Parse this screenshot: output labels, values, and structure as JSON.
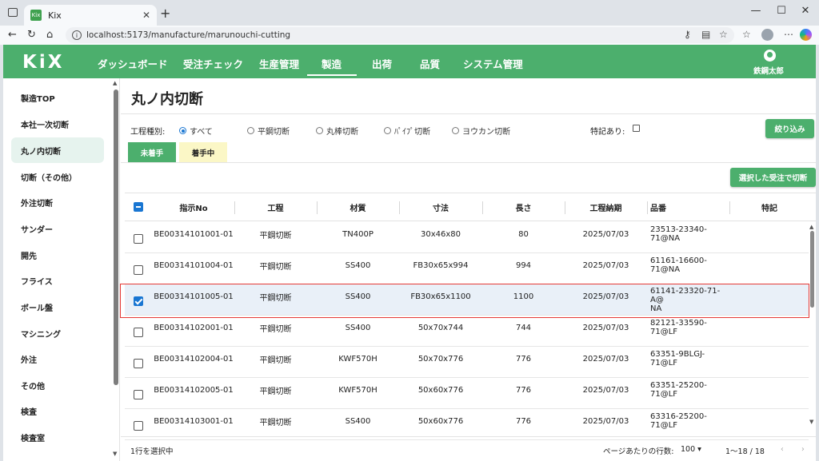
{
  "browser": {
    "tab_title": "Kix",
    "favicon_text": "Kix",
    "url": "localhost:5173/manufacture/marunouchi-cutting"
  },
  "app": {
    "logo": "KiX",
    "menu": [
      {
        "label": "ダッシュボード"
      },
      {
        "label": "受注チェック"
      },
      {
        "label": "生産管理"
      },
      {
        "label": "製造"
      },
      {
        "label": "出荷"
      },
      {
        "label": "品質"
      },
      {
        "label": "システム管理"
      }
    ],
    "active_menu": "製造",
    "user_name": "鉄鋼太郎",
    "accent_color": "#4caf6d"
  },
  "sidebar": {
    "items": [
      {
        "label": "製造TOP"
      },
      {
        "label": "本社一次切断"
      },
      {
        "label": "丸ノ内切断"
      },
      {
        "label": "切断（その他）"
      },
      {
        "label": "外注切断"
      },
      {
        "label": "サンダー"
      },
      {
        "label": "開先"
      },
      {
        "label": "フライス"
      },
      {
        "label": "ボール盤"
      },
      {
        "label": "マシニング"
      },
      {
        "label": "外注"
      },
      {
        "label": "その他"
      },
      {
        "label": "検査"
      },
      {
        "label": "検査室"
      }
    ],
    "active": "丸ノ内切断"
  },
  "page": {
    "title": "丸ノ内切断",
    "filter_label": "工程種別:",
    "radios": [
      {
        "label": "すべて",
        "checked": true
      },
      {
        "label": "平鋼切断",
        "checked": false
      },
      {
        "label": "丸棒切断",
        "checked": false
      },
      {
        "label": "ﾊﾟｲﾌﾟ切断",
        "checked": false
      },
      {
        "label": "ヨウカン切断",
        "checked": false
      }
    ],
    "special_label": "特記あり:",
    "filter_button": "絞り込み",
    "tabs": {
      "unstarted": "未着手",
      "started": "着手中"
    },
    "cut_button": "選択した受注で切断"
  },
  "table": {
    "columns": [
      "指示No",
      "工程",
      "材質",
      "寸法",
      "長さ",
      "工程納期",
      "品番",
      "特記"
    ],
    "rows": [
      {
        "no": "BE00314101001-01",
        "process": "平鋼切断",
        "material": "TN400P",
        "size": "30x46x80",
        "length": "80",
        "due": "2025/07/03",
        "part": "23513-23340-71@NA",
        "note": "",
        "selected": false
      },
      {
        "no": "BE00314101004-01",
        "process": "平鋼切断",
        "material": "SS400",
        "size": "FB30x65x994",
        "length": "994",
        "due": "2025/07/03",
        "part": "61161-16600-71@NA",
        "note": "",
        "selected": false
      },
      {
        "no": "BE00314101005-01",
        "process": "平鋼切断",
        "material": "SS400",
        "size": "FB30x65x1100",
        "length": "1100",
        "due": "2025/07/03",
        "part": "61141-23320-71-A@",
        "part2": "NA",
        "note": "",
        "selected": true
      },
      {
        "no": "BE00314102001-01",
        "process": "平鋼切断",
        "material": "SS400",
        "size": "50x70x744",
        "length": "744",
        "due": "2025/07/03",
        "part": "82121-33590-71@LF",
        "note": "",
        "selected": false
      },
      {
        "no": "BE00314102004-01",
        "process": "平鋼切断",
        "material": "KWF570H",
        "size": "50x70x776",
        "length": "776",
        "due": "2025/07/03",
        "part": "63351-9BLGJ-71@LF",
        "note": "",
        "selected": false
      },
      {
        "no": "BE00314102005-01",
        "process": "平鋼切断",
        "material": "KWF570H",
        "size": "50x60x776",
        "length": "776",
        "due": "2025/07/03",
        "part": "63351-25200-71@LF",
        "note": "",
        "selected": false
      },
      {
        "no": "BE00314103001-01",
        "process": "平鋼切断",
        "material": "SS400",
        "size": "50x60x776",
        "length": "776",
        "due": "2025/07/03",
        "part": "63316-25200-71@LF",
        "note": "",
        "selected": false
      }
    ]
  },
  "footer": {
    "selection_text": "1行を選択中",
    "rows_per_page_label": "ページあたりの行数:",
    "rows_per_page": "100",
    "range": "1〜18 / 18"
  }
}
